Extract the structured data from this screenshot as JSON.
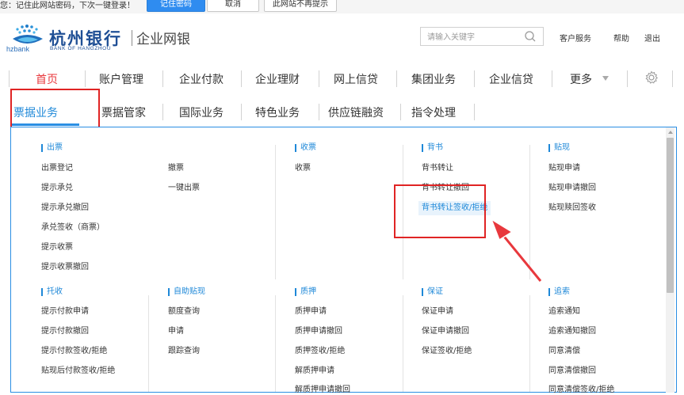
{
  "password_bar": {
    "message": "您：记住此网站密码，下次一键登录！",
    "remember_label": "记住密码",
    "cancel_label": "取消",
    "never_label": "此网站不再提示"
  },
  "header": {
    "logo_hz": "hzbank",
    "logo_cn": "杭州银行",
    "logo_en": "BANK OF HANGZHOU",
    "logo_sub": "企业网银",
    "search_placeholder": "请输入关键字",
    "links": [
      "客户服务",
      "帮助",
      "退出"
    ]
  },
  "main_nav": [
    {
      "label": "首页",
      "active": true
    },
    {
      "label": "账户管理"
    },
    {
      "label": "企业付款"
    },
    {
      "label": "企业理财"
    },
    {
      "label": "网上信贷"
    },
    {
      "label": "集团业务"
    },
    {
      "label": "企业信贷"
    },
    {
      "label": "更多"
    }
  ],
  "sub_nav": [
    {
      "label": "票据业务",
      "active": true
    },
    {
      "label": "票据管家"
    },
    {
      "label": "国际业务"
    },
    {
      "label": "特色业务"
    },
    {
      "label": "供应链融资"
    },
    {
      "label": "指令处理"
    }
  ],
  "menu": {
    "section1": [
      {
        "title": "出票",
        "items": [
          "出票登记",
          "提示承兑",
          "提示承兑撤回",
          "承兑签收（商票）",
          "提示收票",
          "提示收票撤回"
        ]
      },
      {
        "title": "",
        "items": [
          "撤票",
          "一键出票"
        ]
      },
      {
        "title": "收票",
        "items": [
          "收票"
        ]
      },
      {
        "title": "背书",
        "items": [
          "背书转让",
          "背书转让撤回",
          "背书转让签收/拒绝"
        ]
      },
      {
        "title": "贴现",
        "items": [
          "贴现申请",
          "贴现申请撤回",
          "贴现赎回签收"
        ]
      }
    ],
    "section2": [
      {
        "title": "托收",
        "items": [
          "提示付款申请",
          "提示付款撤回",
          "提示付款签收/拒绝",
          "贴现后付款签收/拒绝"
        ]
      },
      {
        "title": "自助贴现",
        "items": [
          "额度查询",
          "申请",
          "跟踪查询"
        ]
      },
      {
        "title": "质押",
        "items": [
          "质押申请",
          "质押申请撤回",
          "质押签收/拒绝",
          "解质押申请",
          "解质押申请撤回"
        ]
      },
      {
        "title": "保证",
        "items": [
          "保证申请",
          "保证申请撤回",
          "保证签收/拒绝"
        ]
      },
      {
        "title": "追索",
        "items": [
          "追索通知",
          "追索通知撤回",
          "同意清偿",
          "同意清偿撤回",
          "同意清偿签收/拒绝"
        ]
      }
    ]
  },
  "colors": {
    "accent_blue": "#1e88d8",
    "active_red": "#e8383d",
    "highlight_box": "#e02424"
  }
}
